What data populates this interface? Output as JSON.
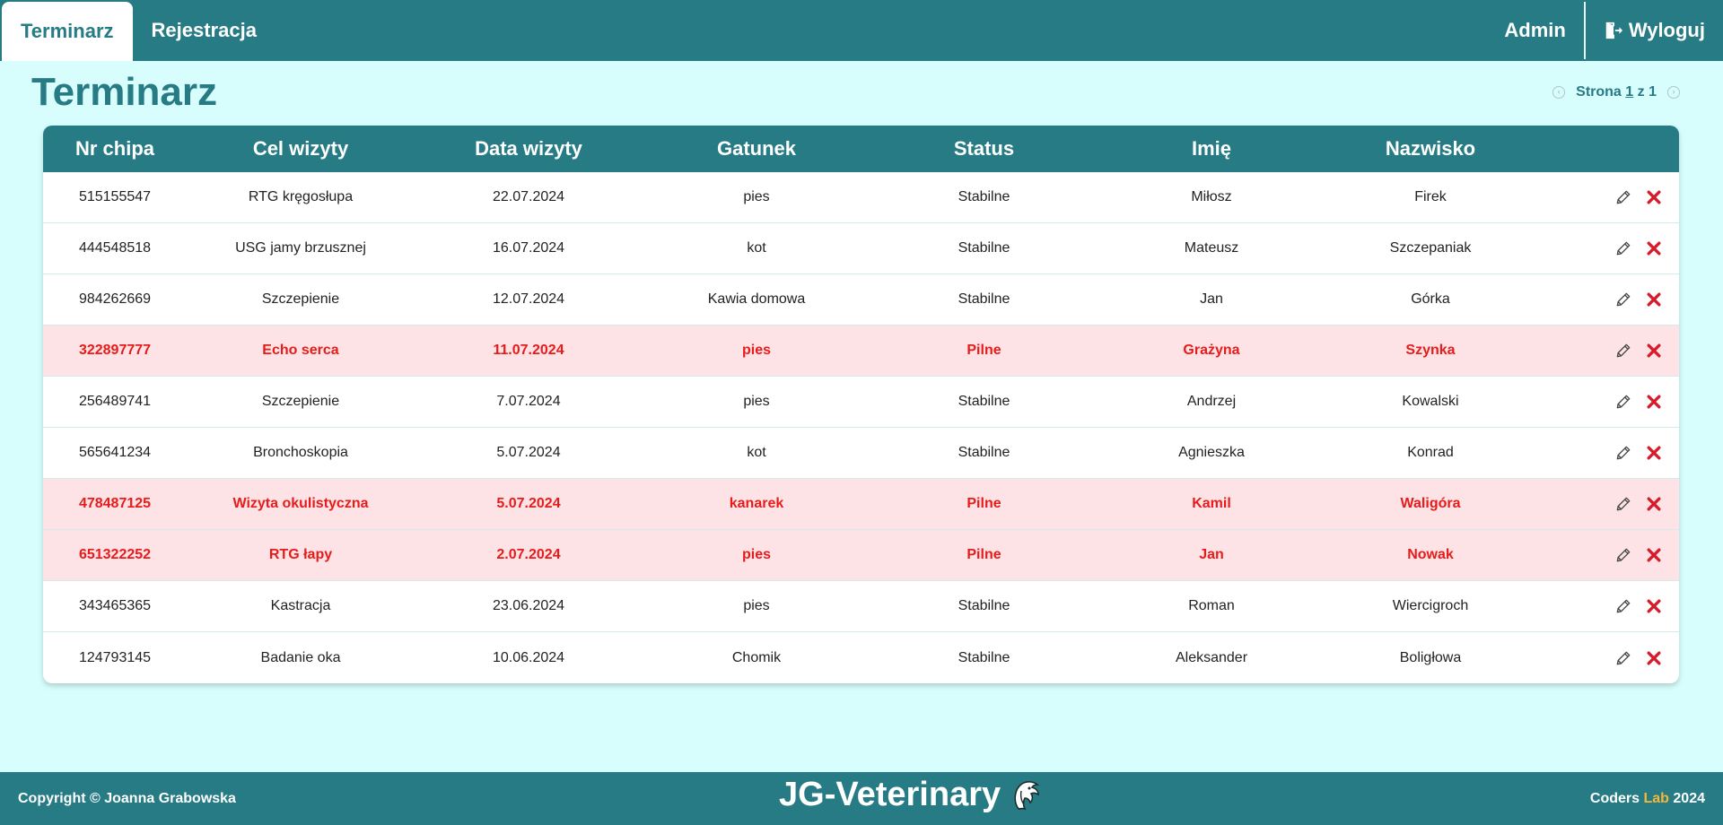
{
  "nav": {
    "tabs": [
      {
        "label": "Terminarz",
        "active": true
      },
      {
        "label": "Rejestracja",
        "active": false
      }
    ],
    "admin_label": "Admin",
    "logout_label": "Wyloguj",
    "logout_icon": "logout-icon"
  },
  "page": {
    "title": "Terminarz",
    "pager": {
      "prefix": "Strona",
      "current": "1",
      "separator": "z",
      "total": "1"
    }
  },
  "table": {
    "columns": [
      "Nr chipa",
      "Cel wizyty",
      "Data wizyty",
      "Gatunek",
      "Status",
      "Imię",
      "Nazwisko"
    ],
    "rows": [
      {
        "chip": "515155547",
        "purpose": "RTG kręgosłupa",
        "date": "22.07.2024",
        "species": "pies",
        "status": "Stabilne",
        "first": "Miłosz",
        "last": "Firek",
        "urgent": false
      },
      {
        "chip": "444548518",
        "purpose": "USG jamy brzusznej",
        "date": "16.07.2024",
        "species": "kot",
        "status": "Stabilne",
        "first": "Mateusz",
        "last": "Szczepaniak",
        "urgent": false
      },
      {
        "chip": "984262669",
        "purpose": "Szczepienie",
        "date": "12.07.2024",
        "species": "Kawia domowa",
        "status": "Stabilne",
        "first": "Jan",
        "last": "Górka",
        "urgent": false
      },
      {
        "chip": "322897777",
        "purpose": "Echo serca",
        "date": "11.07.2024",
        "species": "pies",
        "status": "Pilne",
        "first": "Grażyna",
        "last": "Szynka",
        "urgent": true
      },
      {
        "chip": "256489741",
        "purpose": "Szczepienie",
        "date": "7.07.2024",
        "species": "pies",
        "status": "Stabilne",
        "first": "Andrzej",
        "last": "Kowalski",
        "urgent": false
      },
      {
        "chip": "565641234",
        "purpose": "Bronchoskopia",
        "date": "5.07.2024",
        "species": "kot",
        "status": "Stabilne",
        "first": "Agnieszka",
        "last": "Konrad",
        "urgent": false
      },
      {
        "chip": "478487125",
        "purpose": "Wizyta okulistyczna",
        "date": "5.07.2024",
        "species": "kanarek",
        "status": "Pilne",
        "first": "Kamil",
        "last": "Waligóra",
        "urgent": true
      },
      {
        "chip": "651322252",
        "purpose": "RTG łapy",
        "date": "2.07.2024",
        "species": "pies",
        "status": "Pilne",
        "first": "Jan",
        "last": "Nowak",
        "urgent": true
      },
      {
        "chip": "343465365",
        "purpose": "Kastracja",
        "date": "23.06.2024",
        "species": "pies",
        "status": "Stabilne",
        "first": "Roman",
        "last": "Wiercigroch",
        "urgent": false
      },
      {
        "chip": "124793145",
        "purpose": "Badanie oka",
        "date": "10.06.2024",
        "species": "Chomik",
        "status": "Stabilne",
        "first": "Aleksander",
        "last": "Boligłowa",
        "urgent": false
      }
    ]
  },
  "footer": {
    "copyright_prefix": "Copyright ©",
    "author": "Joanna Grabowska",
    "brand": "JG-Veterinary",
    "brand_icon": "dolphin-icon",
    "credit_coders": "Coders",
    "credit_lab": "Lab",
    "credit_year": "2024"
  },
  "colors": {
    "primary": "#277b84",
    "background": "#d7fdfd",
    "urgent_bg": "#fde3e5",
    "urgent_text": "#e81b1b",
    "delete": "#d81b2a",
    "accent_lab": "#f5b73a"
  }
}
